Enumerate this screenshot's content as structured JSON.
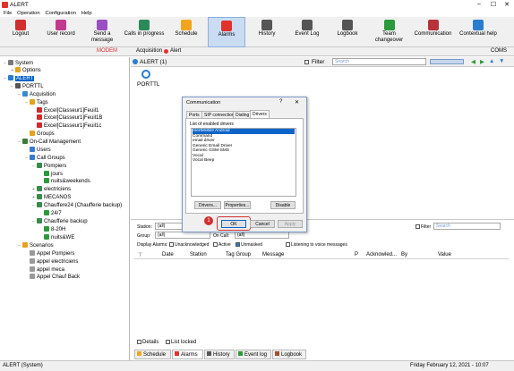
{
  "window": {
    "title": "ALERT"
  },
  "menu": [
    "File",
    "Operation",
    "Configuration",
    "Help"
  ],
  "toolbar": [
    {
      "label": "Logout",
      "icon": "logout-icon",
      "color": "#d12f2f"
    },
    {
      "label": "User record",
      "icon": "user-record-icon",
      "color": "#c23a8e"
    },
    {
      "label": "Send a message",
      "icon": "send-message-icon",
      "color": "#9a4fc2"
    },
    {
      "label": "Calls in progress",
      "icon": "calls-icon",
      "color": "#2a8a5a"
    },
    {
      "label": "Schedule",
      "icon": "schedule-icon",
      "color": "#f2a51c"
    },
    {
      "label": "Alarms",
      "icon": "bell-icon",
      "color": "#e0332b"
    },
    {
      "label": "History",
      "icon": "history-icon",
      "color": "#555555"
    },
    {
      "label": "Event Log",
      "icon": "event-log-icon",
      "color": "#555555"
    },
    {
      "label": "Logbook",
      "icon": "logbook-icon",
      "color": "#555555"
    },
    {
      "label": "Team changeover",
      "icon": "team-changeover-icon",
      "color": "#2a9a3a"
    },
    {
      "label": "Communication",
      "icon": "communication-icon",
      "color": "#b8323a"
    },
    {
      "label": "Contextual help",
      "icon": "help-icon",
      "color": "#2a7cd0"
    }
  ],
  "statusrow": {
    "modem": "MODEM",
    "acquisition": "Acquisition",
    "alert": "Alert",
    "coms": "COMS"
  },
  "tree": [
    {
      "label": "System",
      "depth": 0,
      "icon": "#7a7a7a",
      "exp": "−"
    },
    {
      "label": "Options",
      "depth": 1,
      "icon": "#e6a21a",
      "exp": "+"
    },
    {
      "label": "ALERT",
      "depth": 0,
      "icon": "#2a7cd0",
      "exp": "−",
      "selected": true
    },
    {
      "label": "PORTTL",
      "depth": 1,
      "icon": "#555",
      "exp": "−"
    },
    {
      "label": "Acquisition",
      "depth": 2,
      "icon": "#3a8ad0",
      "exp": "−"
    },
    {
      "label": "Tags",
      "depth": 3,
      "icon": "#e6a21a",
      "exp": "−"
    },
    {
      "label": "Excel[Classeur1]Feuil1",
      "depth": 4,
      "icon": "#d02a2a",
      "exp": ""
    },
    {
      "label": "Excel[Classeur1]Feuil1B",
      "depth": 4,
      "icon": "#d02a2a",
      "exp": ""
    },
    {
      "label": "Excel[Classeur1]Feuil1c",
      "depth": 4,
      "icon": "#d02a2a",
      "exp": ""
    },
    {
      "label": "Groups",
      "depth": 3,
      "icon": "#e6a21a",
      "exp": ""
    },
    {
      "label": "On-Call Management",
      "depth": 2,
      "icon": "#3a7a3a",
      "exp": "−"
    },
    {
      "label": "Users",
      "depth": 3,
      "icon": "#3a7ad0",
      "exp": ""
    },
    {
      "label": "Call Groups",
      "depth": 3,
      "icon": "#3a7ad0",
      "exp": "−"
    },
    {
      "label": "Pompiers",
      "depth": 4,
      "icon": "#3a8a4a",
      "exp": "−"
    },
    {
      "label": "jours",
      "depth": 5,
      "icon": "#2a9a3a",
      "exp": ""
    },
    {
      "label": "nuits&weekends",
      "depth": 5,
      "icon": "#2a9a3a",
      "exp": ""
    },
    {
      "label": "electriciens",
      "depth": 4,
      "icon": "#3a8a4a",
      "exp": "+"
    },
    {
      "label": "MECANOS",
      "depth": 4,
      "icon": "#3a8a4a",
      "exp": "+"
    },
    {
      "label": "Chauffere24 (Chaufferie backup)",
      "depth": 4,
      "icon": "#3a8a4a",
      "exp": "−"
    },
    {
      "label": "24/7",
      "depth": 5,
      "icon": "#2a9a3a",
      "exp": ""
    },
    {
      "label": "Chaufferie backup",
      "depth": 4,
      "icon": "#3a8a4a",
      "exp": "−"
    },
    {
      "label": "8-20H",
      "depth": 5,
      "icon": "#2a9a3a",
      "exp": ""
    },
    {
      "label": "nuits&WE",
      "depth": 5,
      "icon": "#2a9a3a",
      "exp": ""
    },
    {
      "label": "Scenarios",
      "depth": 2,
      "icon": "#e6a21a",
      "exp": "−"
    },
    {
      "label": "Appel Pompiers",
      "depth": 3,
      "icon": "#999",
      "exp": ""
    },
    {
      "label": "appel electriciens",
      "depth": 3,
      "icon": "#999",
      "exp": ""
    },
    {
      "label": "appel meca",
      "depth": 3,
      "icon": "#999",
      "exp": ""
    },
    {
      "label": "Appel Chauf Back",
      "depth": 3,
      "icon": "#999",
      "exp": ""
    }
  ],
  "subheader": {
    "title": "ALERT (1)",
    "filter": "Filter",
    "search_placeholder": "Search"
  },
  "station_label": "PORTTL",
  "dialog": {
    "title": "Communication",
    "help": "?",
    "close": "✕",
    "tabs": [
      "Ports",
      "SIP connection",
      "Dialing",
      "Drivers"
    ],
    "list_label": "List of enabled drivers",
    "drivers": [
      "AlertMobile Android",
      "Command",
      "email driver",
      "Generic Email Driver",
      "Generic GSM-SMS",
      "Vocal",
      "Vocal Beep"
    ],
    "buttons": {
      "drivers": "Drivers...",
      "properties": "Properties...",
      "disable": "Disable",
      "ok": "OK",
      "cancel": "Cancel",
      "apply": "Apply"
    },
    "marker": "1"
  },
  "lower": {
    "station_label": "Station:",
    "station_value": "(all)",
    "group_label": "Group:",
    "group_value": "(all)",
    "oncall_label": "On Call:",
    "oncall_value": "(all)",
    "display_label": "Display Alarms:",
    "unacknowledged": "Unacknowledged",
    "active": "Active",
    "unmasked": "Unmasked",
    "listening": "Listening to voice messages",
    "filter": "Filter",
    "search_placeholder": "Search",
    "columns": [
      "Date",
      "Station",
      "Tag Group",
      "Message",
      "P",
      "Acknowled...",
      "By",
      "Value"
    ],
    "details": "Details",
    "list_locked": "List locked",
    "tabs": [
      "Schedule",
      "Alarms",
      "History",
      "Event log",
      "Logbook"
    ]
  },
  "statusbar": {
    "left": "ALERT (System)",
    "right": "Friday February 12, 2021 - 10:07"
  },
  "colors": {
    "accent": "#0a64c8",
    "alarm": "#e0332b",
    "highlight_ring": "#d32f2f"
  }
}
